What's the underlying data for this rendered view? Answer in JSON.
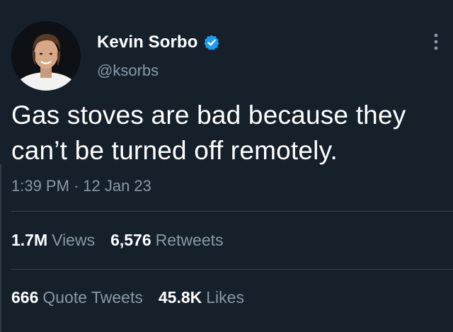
{
  "author": {
    "display_name": "Kevin Sorbo",
    "handle": "@ksorbs",
    "verified_icon": "verified-badge-icon"
  },
  "tweet": {
    "text_line1": "Gas stoves are bad because they",
    "text_line2": "can’t be turned off remotely.",
    "time": "1:39 PM",
    "separator": "·",
    "date": "12 Jan 23"
  },
  "stats": {
    "views_count": "1.7M",
    "views_label": "Views",
    "retweets_count": "6,576",
    "retweets_label": "Retweets",
    "quotes_count": "666",
    "quotes_label": "Quote Tweets",
    "likes_count": "45.8K",
    "likes_label": "Likes"
  },
  "colors": {
    "background": "#15202b",
    "secondary_text": "#8899a6",
    "verified_blue": "#1d9bf0",
    "divider": "#38444d"
  }
}
